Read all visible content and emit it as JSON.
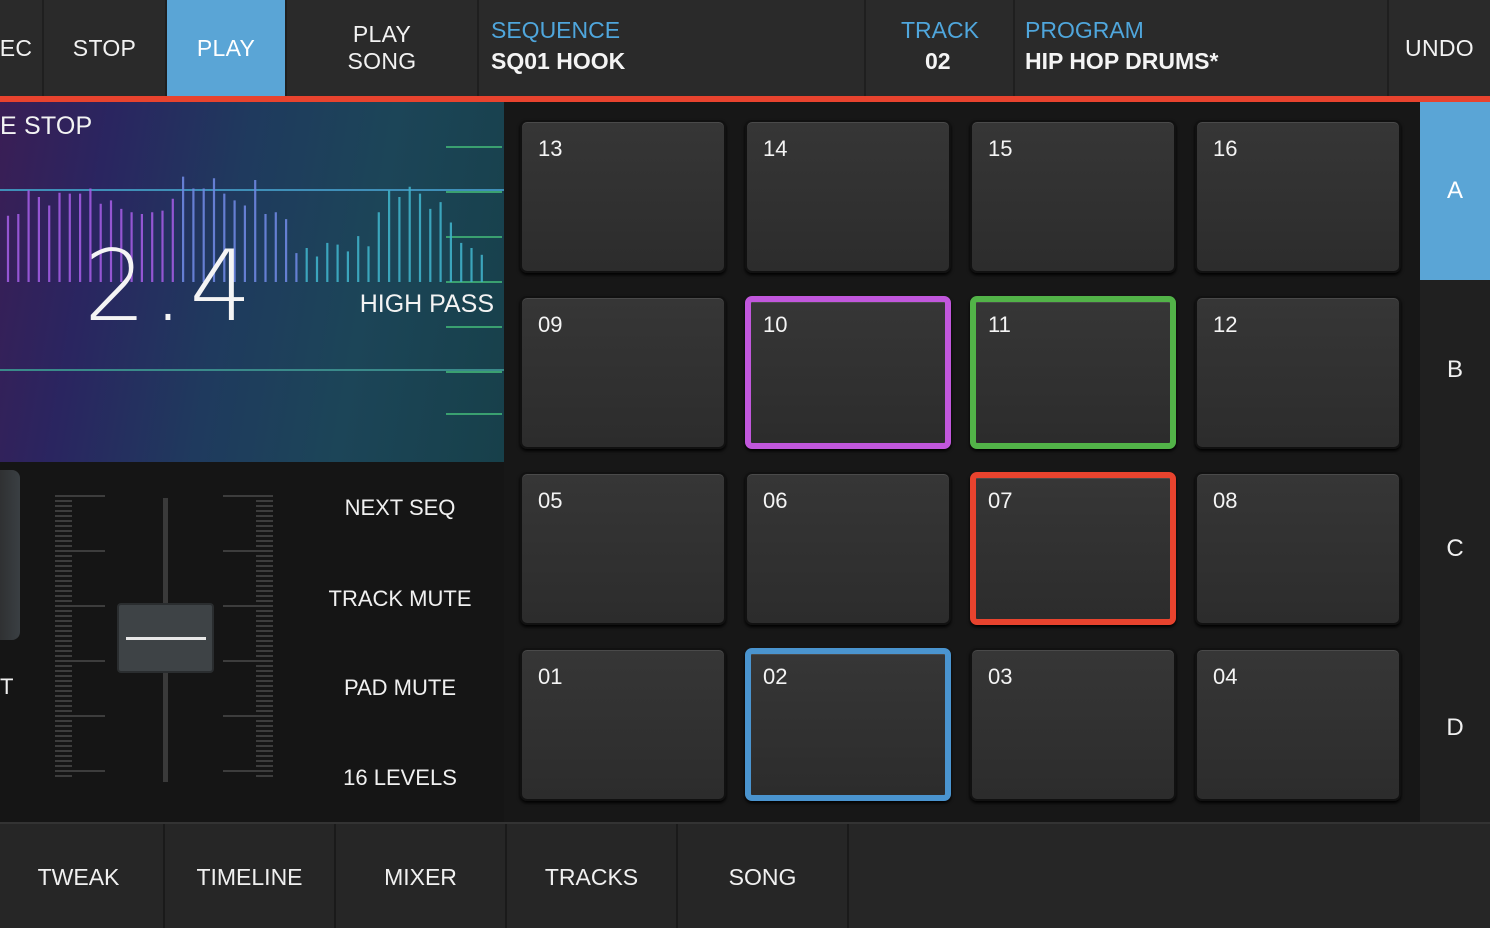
{
  "topbar": {
    "rec_partial": "EC",
    "stop": "STOP",
    "play": "PLAY",
    "play_song": "PLAY\nSONG",
    "sequence_label": "SEQUENCE",
    "sequence_value": "SQ01 HOOK",
    "track_label": "TRACK",
    "track_value": "02",
    "program_label": "PROGRAM",
    "program_value": "HIP HOP DRUMS*",
    "undo": "UNDO"
  },
  "visualizer": {
    "title_partial": "E STOP",
    "value": "2.4",
    "filter_label": "HIGH PASS"
  },
  "controls": {
    "next_seq": "NEXT SEQ",
    "track_mute": "TRACK MUTE",
    "pad_mute": "PAD MUTE",
    "sixteen_levels": "16 LEVELS",
    "cut_partial": "T"
  },
  "pads": [
    {
      "num": "13"
    },
    {
      "num": "14"
    },
    {
      "num": "15"
    },
    {
      "num": "16"
    },
    {
      "num": "09"
    },
    {
      "num": "10",
      "color": "#c157dc"
    },
    {
      "num": "11",
      "color": "#52b348"
    },
    {
      "num": "12"
    },
    {
      "num": "05"
    },
    {
      "num": "06"
    },
    {
      "num": "07",
      "color": "#e8432e"
    },
    {
      "num": "08"
    },
    {
      "num": "01"
    },
    {
      "num": "02",
      "color": "#4a94cf"
    },
    {
      "num": "03"
    },
    {
      "num": "04"
    }
  ],
  "banks": [
    "A",
    "B",
    "C",
    "D"
  ],
  "active_bank": "A",
  "bottom_tabs": [
    "TWEAK",
    "TIMELINE",
    "MIXER",
    "TRACKS",
    "SONG"
  ],
  "colors": {
    "accent_blue": "#5aa5d6",
    "accent_red": "#e8432e",
    "pad_purple": "#c157dc",
    "pad_green": "#52b348",
    "pad_blue": "#4a94cf"
  }
}
